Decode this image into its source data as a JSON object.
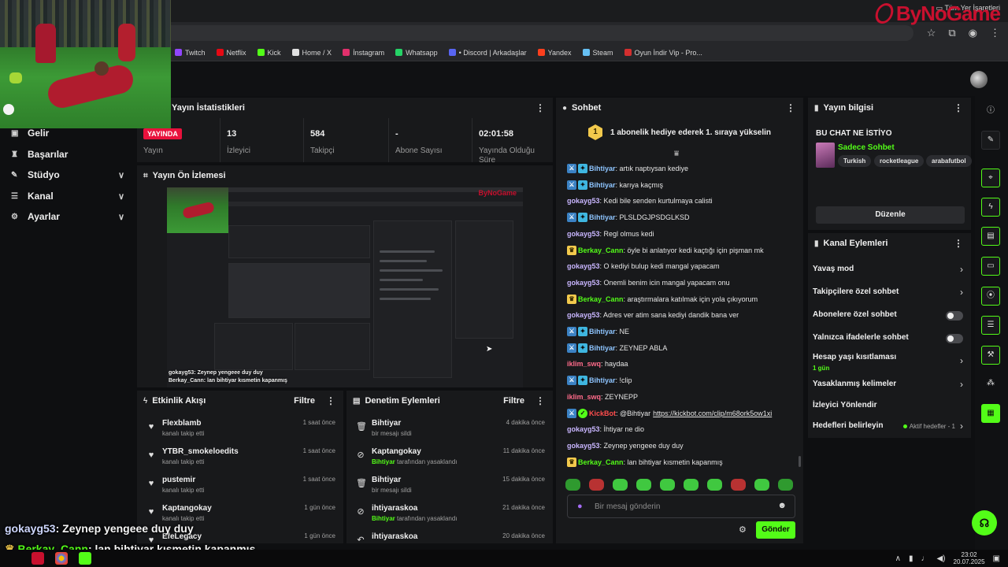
{
  "browser": {
    "bookmarks": [
      {
        "label": "Twitch",
        "color": "#9146ff"
      },
      {
        "label": "Netflix",
        "color": "#e50914"
      },
      {
        "label": "Kick",
        "color": "#53fc18"
      },
      {
        "label": "Home / X",
        "color": "#e0e0e0"
      },
      {
        "label": "İnstagram",
        "color": "#e1306c"
      },
      {
        "label": "Whatsapp",
        "color": "#25d366"
      },
      {
        "label": "• Discord | Arkadaşlar",
        "color": "#5865f2"
      },
      {
        "label": "Yandex",
        "color": "#fc3f1d"
      },
      {
        "label": "Steam",
        "color": "#66c0f4"
      },
      {
        "label": "Oyun İndir Vip - Pro...",
        "color": "#d32f2f"
      }
    ],
    "all_bookmarks_label": "Tüm Yer İşaretleri"
  },
  "brand": {
    "logo_text": "ByNoGame"
  },
  "nav": {
    "items": [
      {
        "label": "Gelir",
        "icon": "cash-icon"
      },
      {
        "label": "Başarılar",
        "icon": "trophy-icon"
      },
      {
        "label": "Stüdyo",
        "icon": "studio-icon",
        "expandable": true
      },
      {
        "label": "Kanal",
        "icon": "channel-icon",
        "expandable": true
      },
      {
        "label": "Ayarlar",
        "icon": "gear-icon",
        "expandable": true
      }
    ]
  },
  "stats": {
    "title": "Yayın İstatistikleri",
    "live_badge": "YAYINDA",
    "items": [
      {
        "label": "Yayın",
        "value": ""
      },
      {
        "label": "İzleyici",
        "value": "13"
      },
      {
        "label": "Takipçi",
        "value": "584"
      },
      {
        "label": "Abone Sayısı",
        "value": "-"
      },
      {
        "label": "Yayında Olduğu Süre",
        "value": "02:01:58"
      }
    ]
  },
  "preview": {
    "title": "Yayın Ön İzlemesi",
    "captions": [
      {
        "user": "gokayg53",
        "text": ": Zeynep yengeee duy duy"
      },
      {
        "user": "Berkay_Cann",
        "text": ": lan bihtiyar kısmetin kapanmış"
      }
    ]
  },
  "activity": {
    "title": "Etkinlik Akışı",
    "filter_label": "Filtre",
    "rows": [
      {
        "name": "Flexblamb",
        "sub": "kanalı takip etti",
        "time": "1 saat önce"
      },
      {
        "name": "YTBR_smokeloedits",
        "sub": "kanalı takip etti",
        "time": "1 saat önce"
      },
      {
        "name": "pustemir",
        "sub": "kanalı takip etti",
        "time": "1 saat önce"
      },
      {
        "name": "Kaptangokay",
        "sub": "kanalı takip etti",
        "time": "1 gün önce"
      },
      {
        "name": "EfeLegacy",
        "sub": "",
        "time": "1 gün önce"
      }
    ]
  },
  "moderation": {
    "title": "Denetim Eylemleri",
    "filter_label": "Filtre",
    "rows": [
      {
        "name": "Bihtiyar",
        "actor": "",
        "sub": "bir mesajı sildi",
        "time": "4 dakika önce",
        "icon": "trash-icon"
      },
      {
        "name": "Kaptangokay",
        "actor": "Bihtiyar",
        "sub": " tarafından yasaklandı",
        "time": "11 dakika önce",
        "icon": "ban-icon"
      },
      {
        "name": "Bihtiyar",
        "actor": "",
        "sub": "bir mesajı sildi",
        "time": "15 dakika önce",
        "icon": "trash-icon"
      },
      {
        "name": "ihtiyaraskoa",
        "actor": "Bihtiyar",
        "sub": " tarafından yasaklandı",
        "time": "21 dakika önce",
        "icon": "ban-icon"
      },
      {
        "name": "ihtiyaraskoa",
        "actor": "",
        "sub": "",
        "time": "20 dakika önce",
        "icon": "undo-icon"
      }
    ]
  },
  "chat": {
    "title": "Sohbet",
    "banner_rank": "1",
    "banner_text": "1 abonelik hediye ederek 1. sıraya yükselin",
    "messages": [
      {
        "user": "Bihtiyar",
        "text": ": artık naptıysan kediye",
        "color": "#8ec5ff",
        "badges": [
          "mod",
          "vip"
        ]
      },
      {
        "user": "Bihtiyar",
        "text": ": karıya kaçmış",
        "color": "#8ec5ff",
        "badges": [
          "mod",
          "vip"
        ]
      },
      {
        "user": "gokayg53",
        "text": ": Kedi bile senden kurtulmaya calisti",
        "color": "#c9b6ff",
        "badges": []
      },
      {
        "user": "Bihtiyar",
        "text": ": PLSLDGJPSDGLKSD",
        "color": "#8ec5ff",
        "badges": [
          "mod",
          "vip"
        ]
      },
      {
        "user": "gokayg53",
        "text": ": Regl olmus kedi",
        "color": "#c9b6ff",
        "badges": []
      },
      {
        "user": "Berkay_Cann",
        "text": ": öyle bi anlatıyor kedi kaçtığı için pişman mk",
        "color": "#53fc18",
        "badges": [
          "crown"
        ]
      },
      {
        "user": "gokayg53",
        "text": ": O kediyi bulup kedi mangal yapacam",
        "color": "#c9b6ff",
        "badges": []
      },
      {
        "user": "gokayg53",
        "text": ": Onemli benim icin mangal yapacam onu",
        "color": "#c9b6ff",
        "badges": []
      },
      {
        "user": "Berkay_Cann",
        "text": ": araştırmalara katılmak için yola çıkıyorum",
        "color": "#53fc18",
        "badges": [
          "crown"
        ]
      },
      {
        "user": "gokayg53",
        "text": ": Adres ver atim sana kediyi dandik bana ver",
        "color": "#c9b6ff",
        "badges": []
      },
      {
        "user": "Bihtiyar",
        "text": ": NE",
        "color": "#8ec5ff",
        "badges": [
          "mod",
          "vip"
        ]
      },
      {
        "user": "Bihtiyar",
        "text": ": ZEYNEP ABLA",
        "color": "#8ec5ff",
        "badges": [
          "mod",
          "vip"
        ]
      },
      {
        "user": "iklim_swq",
        "text": ": haydaa",
        "color": "#ff6b8a",
        "badges": []
      },
      {
        "user": "Bihtiyar",
        "text": ": !clip",
        "color": "#8ec5ff",
        "badges": [
          "mod",
          "vip"
        ]
      },
      {
        "user": "iklim_swq",
        "text": ": ZEYNEPP",
        "color": "#ff6b8a",
        "badges": []
      },
      {
        "user": "KickBot",
        "text": ": @Bihtiyar",
        "link": "https://kickbot.com/clip/m68ork5ow1xi",
        "color": "#ff4d4d",
        "badges": [
          "mod",
          "bot"
        ]
      },
      {
        "user": "gokayg53",
        "text": ": İhtiyar ne dio",
        "color": "#c9b6ff",
        "badges": []
      },
      {
        "user": "gokayg53",
        "text": ": Zeynep yengeee duy duy",
        "color": "#c9b6ff",
        "badges": []
      },
      {
        "user": "Berkay_Cann",
        "text": ": lan bihtiyar kısmetin kapanmış",
        "color": "#53fc18",
        "badges": [
          "crown"
        ]
      }
    ],
    "input_placeholder": "Bir mesaj gönderin",
    "send_label": "Gönder"
  },
  "stream_info": {
    "title": "Yayın bilgisi",
    "stream_title": "BU CHAT NE İSTİYO",
    "category": "Sadece Sohbet",
    "tags": [
      "Turkish",
      "rocketleague",
      "arabafutbol"
    ],
    "edit_label": "Düzenle"
  },
  "channel_actions": {
    "title": "Kanal Eylemleri",
    "rows": [
      {
        "label": "Yavaş mod",
        "type": "chevron",
        "sub": ""
      },
      {
        "label": "Takipçilere özel sohbet",
        "type": "chevron",
        "sub": ""
      },
      {
        "label": "Abonelere özel sohbet",
        "type": "toggle",
        "sub": ""
      },
      {
        "label": "Yalnızca ifadelerle sohbet",
        "type": "toggle",
        "sub": ""
      },
      {
        "label": "Hesap yaşı kısıtlaması",
        "type": "chevron",
        "sub": "1 gün"
      },
      {
        "label": "Yasaklanmış kelimeler",
        "type": "chevron",
        "sub": ""
      },
      {
        "label": "İzleyici Yönlendir",
        "type": "none",
        "sub": ""
      },
      {
        "label": "Hedefleri belirleyin",
        "type": "chevron",
        "sub": "",
        "status": "Aktif hedefler - 1"
      }
    ]
  },
  "overlay_captions": [
    {
      "user": "gokayg53",
      "text": ": Zeynep yengeee duy duy"
    },
    {
      "user": "Berkay_Cann",
      "text": ": lan bihtiyar kısmetin kapanmış"
    }
  ],
  "taskbar": {
    "time": "23:02",
    "date": "20.07.2025"
  }
}
